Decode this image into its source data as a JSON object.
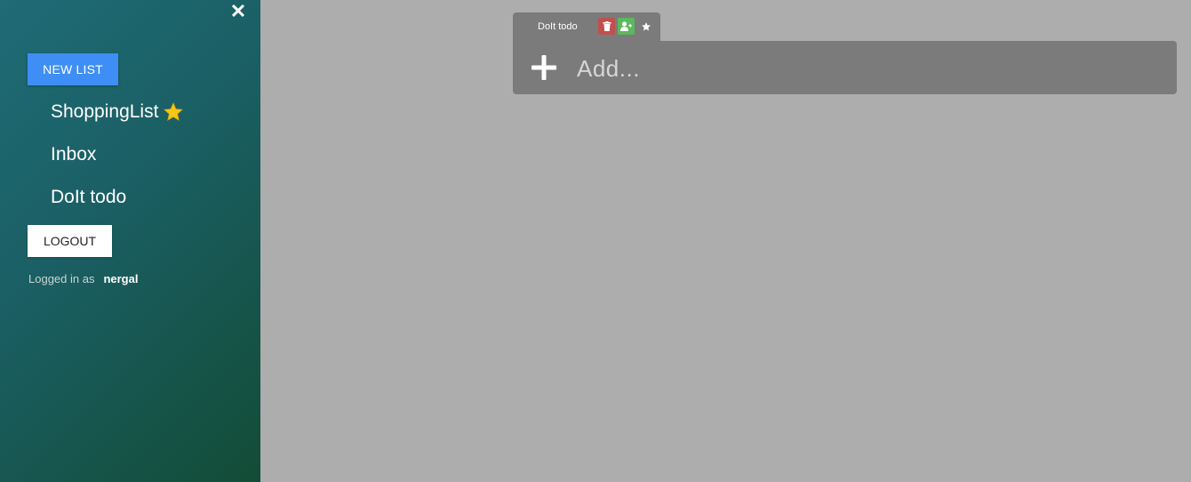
{
  "sidebar": {
    "close_symbol": "✕",
    "new_list_label": "NEW LIST",
    "lists": [
      {
        "label": "ShoppingList",
        "favorite": true,
        "icon": "star-icon"
      },
      {
        "label": "Inbox",
        "favorite": false
      },
      {
        "label": "DoIt todo",
        "favorite": false
      }
    ],
    "logout_label": "LOGOUT",
    "logged_in_prefix": "Logged in as",
    "username": "nergal"
  },
  "list_view": {
    "tab_title": "DoIt todo",
    "actions": [
      {
        "icon": "trash-icon",
        "color": "#c0504d"
      },
      {
        "icon": "add-user-icon",
        "color": "#5cb85c"
      },
      {
        "icon": "star-icon",
        "color": "#ffffff"
      }
    ],
    "add_placeholder": "Add...",
    "add_value": ""
  },
  "colors": {
    "background": "#adadad",
    "panel": "#7b7b7b",
    "accent": "#3e8ef5",
    "favorite_star": "#f5c518"
  }
}
